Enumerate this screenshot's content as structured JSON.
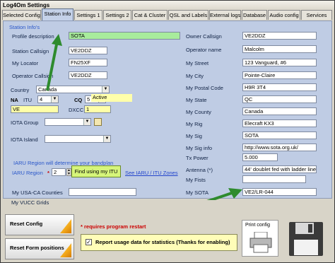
{
  "window": {
    "title": "Log4Om Settings"
  },
  "tabs": [
    "Selected Config",
    "Station Info",
    "Settings 1",
    "Settings 2",
    "Cat & Cluster",
    "QSL and Labels",
    "External logs",
    "Database",
    "Audio config",
    "Services"
  ],
  "left": {
    "section_title": "Station Info's",
    "profile_label": "Profile description",
    "profile_value": "SOTA",
    "callsign_label": "Station Callsign",
    "callsign_value": "VE2DDZ",
    "locator_label": "My Locator",
    "locator_value": "FN25XF",
    "operator_label": "Operator Callsign",
    "operator_value": "VE2DDZ",
    "country_label": "Country",
    "country_value": "Canada",
    "na_label": "NA",
    "itu_label": "ITU",
    "itu_value": "4",
    "cq_label": "CQ",
    "cq_value": "5",
    "active_value": "Active",
    "ve_value": "VE",
    "dxcc_label": "DXCC",
    "dxcc_value": "1",
    "iota_group_label": "IOTA Group",
    "iota_island_label": "IOTA Island",
    "iaru_note": "IARU Region will determine your bandplan",
    "iaru_label": "IARU Region",
    "iaru_asterisk": "*",
    "iaru_value": "2",
    "find_itu_button": "Find using my ITU",
    "iaru_link": "See IARU / ITU Zones",
    "usaca_label": "My USA-CA Counties",
    "vucc_label": "My VUCC Grids"
  },
  "right": {
    "owner_label": "Owner Callsign",
    "owner_value": "VE2DDZ",
    "opname_label": "Operator name",
    "opname_value": "Malcolm",
    "street_label": "My Street",
    "street_value": "123 Vanguard, #6",
    "city_label": "My City",
    "city_value": "Pointe-Claire",
    "postal_label": "My Postal Code",
    "postal_value": "H9R 3T4",
    "state_label": "My State",
    "state_value": "QC",
    "county_label": "My County",
    "county_value": "Canada",
    "rig_label": "My Rig",
    "rig_value": "Elecraft KX3",
    "sig_label": "My Sig",
    "sig_value": "SOTA",
    "siginfo_label": "My Sig info",
    "siginfo_value": "http://www.sota.org.uk/",
    "txpower_label": "Tx Power",
    "txpower_value": "5.000",
    "antenna_label": "Antenna (*)",
    "antenna_value": "44' doublet fed with ladder line.",
    "fists_label": "My Fists",
    "fists_value": "",
    "sota_label": "My SOTA",
    "sota_value": "VE2/LR-044"
  },
  "bottom": {
    "reset_config": "Reset Config",
    "reset_form": "Reset Form positions",
    "restart_note": "* requires program restart",
    "report_usage": "Report usage data for statistics (Thanks for enabling)",
    "print_config": "Print config"
  },
  "colors": {
    "panel": "#bfcce4",
    "green_field": "#a8ec9c",
    "arrow": "#2e8b2e"
  }
}
